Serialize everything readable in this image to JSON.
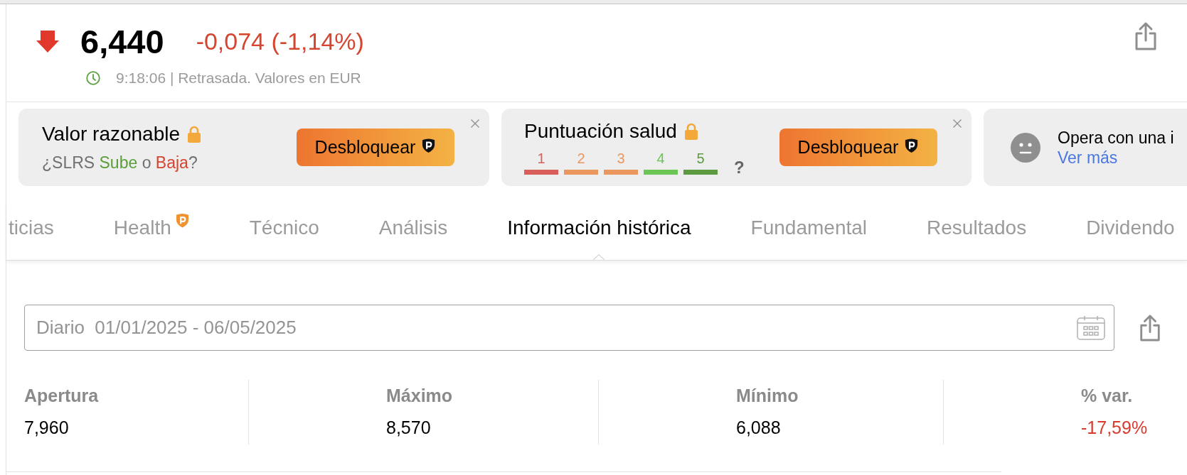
{
  "quote": {
    "falling": true,
    "price": "6,440",
    "change": "-0,074 (-1,14%)",
    "status": "9:18:06 | Retrasada. Valores en EUR"
  },
  "cards": [
    {
      "kind": "fair_value",
      "title": "Valor razonable",
      "locked": true,
      "question": [
        {
          "text": "¿SLRS ",
          "color": "#707070"
        },
        {
          "text": "Sube",
          "color": "#5a9e3a"
        },
        {
          "text": " o ",
          "color": "#707070"
        },
        {
          "text": "Baja",
          "color": "#d5452f"
        },
        {
          "text": "?",
          "color": "#707070"
        }
      ],
      "button": "Desbloquear",
      "closable": true
    },
    {
      "kind": "health_score",
      "title": "Puntuación salud",
      "locked": true,
      "scale": [
        {
          "label": "1",
          "color": "#d9605a"
        },
        {
          "label": "2",
          "color": "#ea975f"
        },
        {
          "label": "3",
          "color": "#ea975f"
        },
        {
          "label": "4",
          "color": "#6cc655"
        },
        {
          "label": "5",
          "color": "#5d9b41"
        }
      ],
      "score": "?",
      "button": "Desbloquear",
      "closable": true
    },
    {
      "kind": "broker",
      "text": "Opera con una i",
      "link": "Ver más"
    }
  ],
  "tabs": [
    {
      "label": "ticias",
      "selected": false,
      "premium": false
    },
    {
      "label": "Health",
      "selected": false,
      "premium": true
    },
    {
      "label": "Técnico",
      "selected": false,
      "premium": false
    },
    {
      "label": "Análisis",
      "selected": false,
      "premium": false
    },
    {
      "label": "Información histórica",
      "selected": true,
      "premium": false
    },
    {
      "label": "Fundamental",
      "selected": false,
      "premium": false
    },
    {
      "label": "Resultados",
      "selected": false,
      "premium": false
    },
    {
      "label": "Dividendo",
      "selected": false,
      "premium": false
    }
  ],
  "date_range": {
    "value": "Diario  01/01/2025 - 06/05/2025"
  },
  "stats": [
    {
      "label": "Apertura",
      "value": "7,960",
      "negative": false
    },
    {
      "label": "Máximo",
      "value": "8,570",
      "negative": false
    },
    {
      "label": "Mínimo",
      "value": "6,088",
      "negative": false
    },
    {
      "label": "% var.",
      "value": "-17,59%",
      "negative": true
    }
  ]
}
